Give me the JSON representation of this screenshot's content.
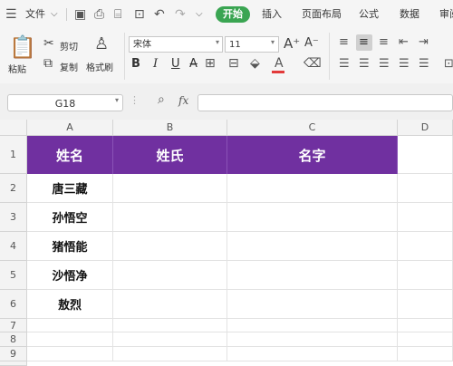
{
  "menubar": {
    "file_label": "文件",
    "tabs": [
      "开始",
      "插入",
      "页面布局",
      "公式",
      "数据",
      "审阅"
    ]
  },
  "ribbon": {
    "paste_label": "粘贴",
    "cut_label": "剪切",
    "copy_label": "复制",
    "format_painter_label": "格式刷",
    "font_name": "宋体",
    "font_size": "11",
    "bold": "B",
    "italic": "I",
    "underline": "U"
  },
  "formula_bar": {
    "name_box": "G18",
    "fx_label": "fx",
    "content": ""
  },
  "sheet": {
    "columns": [
      "A",
      "B",
      "C",
      "D"
    ],
    "rows": [
      "1",
      "2",
      "3",
      "4",
      "5",
      "6",
      "7",
      "8",
      "9"
    ],
    "header_row": [
      "姓名",
      "姓氏",
      "名字"
    ],
    "names": [
      "唐三藏",
      "孙悟空",
      "猪悟能",
      "沙悟净",
      "敖烈"
    ]
  },
  "colors": {
    "header_fill": "#7030a0",
    "accent": "#3aa552"
  }
}
